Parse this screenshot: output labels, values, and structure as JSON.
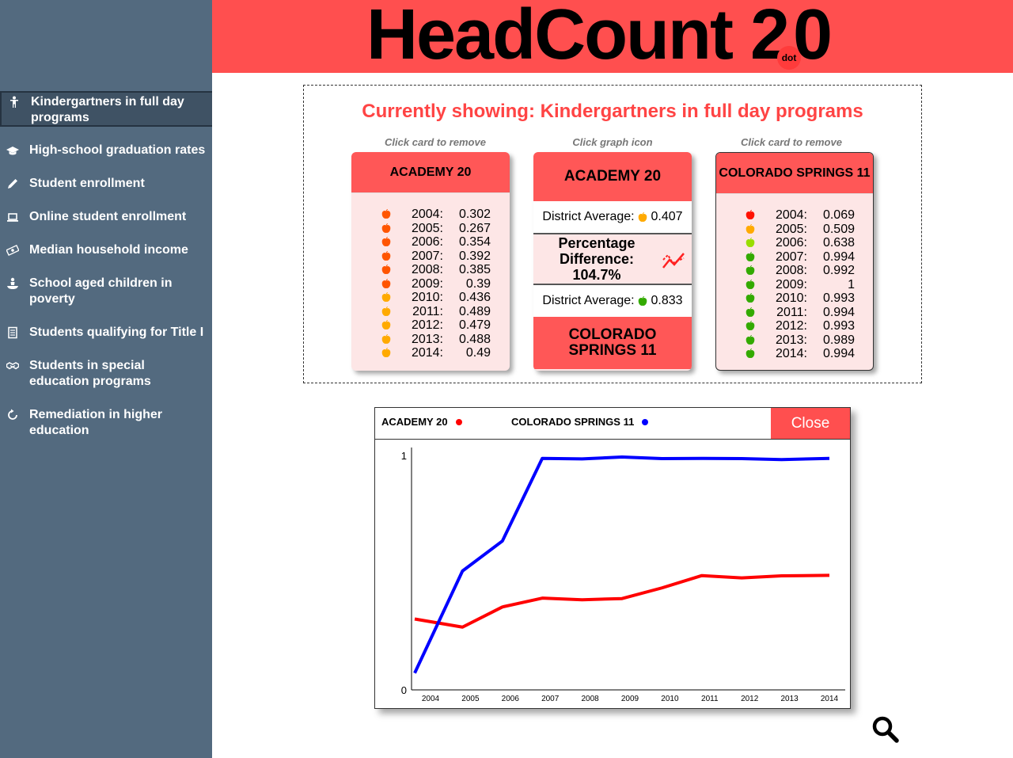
{
  "app": {
    "title_main": "HeadCount 2",
    "title_dot": "dot",
    "title_end": "0"
  },
  "sidebar": {
    "items": [
      {
        "label": "Kindergartners in full day programs",
        "icon": "child-icon",
        "active": true
      },
      {
        "label": "High-school graduation rates",
        "icon": "graduation-cap-icon",
        "active": false
      },
      {
        "label": "Student enrollment",
        "icon": "pencil-icon",
        "active": false
      },
      {
        "label": "Online student enrollment",
        "icon": "laptop-icon",
        "active": false
      },
      {
        "label": "Median household income",
        "icon": "money-icon",
        "active": false
      },
      {
        "label": "School aged children in poverty",
        "icon": "child-bowl-icon",
        "active": false
      },
      {
        "label": "Students qualifying for Title I",
        "icon": "document-icon",
        "active": false
      },
      {
        "label": "Students in special education programs",
        "icon": "handshake-icon",
        "active": false
      },
      {
        "label": "Remediation in higher education",
        "icon": "refresh-icon",
        "active": false
      }
    ]
  },
  "compare": {
    "showing": "Currently showing: Kindergartners in full day programs",
    "hint_left": "Click card to remove",
    "hint_middle": "Click graph icon",
    "hint_right": "Click card to remove",
    "left_card": {
      "title": "ACADEMY 20",
      "rows": [
        {
          "year": "2004:",
          "value": "0.302",
          "color": "#ff5500"
        },
        {
          "year": "2005:",
          "value": "0.267",
          "color": "#ff5500"
        },
        {
          "year": "2006:",
          "value": "0.354",
          "color": "#ff5500"
        },
        {
          "year": "2007:",
          "value": "0.392",
          "color": "#ff5500"
        },
        {
          "year": "2008:",
          "value": "0.385",
          "color": "#ff5500"
        },
        {
          "year": "2009:",
          "value": "0.39",
          "color": "#ff5500"
        },
        {
          "year": "2010:",
          "value": "0.436",
          "color": "#ffaa00"
        },
        {
          "year": "2011:",
          "value": "0.489",
          "color": "#ffaa00"
        },
        {
          "year": "2012:",
          "value": "0.479",
          "color": "#ffaa00"
        },
        {
          "year": "2013:",
          "value": "0.488",
          "color": "#ffaa00"
        },
        {
          "year": "2014:",
          "value": "0.49",
          "color": "#ffaa00"
        }
      ]
    },
    "middle_card": {
      "top_title": "ACADEMY 20",
      "avg_label": "District Average:",
      "avg_top_value": "0.407",
      "avg_top_color": "#ffaa00",
      "pct_line1": "Percentage",
      "pct_line2": "Difference:",
      "pct_value": "104.7%",
      "avg_bottom_value": "0.833",
      "avg_bottom_color": "#33aa00",
      "bottom_title": "COLORADO SPRINGS 11"
    },
    "right_card": {
      "title": "COLORADO SPRINGS 11",
      "rows": [
        {
          "year": "2004:",
          "value": "0.069",
          "color": "#ff1100"
        },
        {
          "year": "2005:",
          "value": "0.509",
          "color": "#ffaa00"
        },
        {
          "year": "2006:",
          "value": "0.638",
          "color": "#99dd00"
        },
        {
          "year": "2007:",
          "value": "0.994",
          "color": "#33aa00"
        },
        {
          "year": "2008:",
          "value": "0.992",
          "color": "#33aa00"
        },
        {
          "year": "2009:",
          "value": "1",
          "color": "#33aa00"
        },
        {
          "year": "2010:",
          "value": "0.993",
          "color": "#33aa00"
        },
        {
          "year": "2011:",
          "value": "0.994",
          "color": "#33aa00"
        },
        {
          "year": "2012:",
          "value": "0.993",
          "color": "#33aa00"
        },
        {
          "year": "2013:",
          "value": "0.989",
          "color": "#33aa00"
        },
        {
          "year": "2014:",
          "value": "0.994",
          "color": "#33aa00"
        }
      ]
    }
  },
  "graph": {
    "close_label": "Close"
  },
  "chart_data": {
    "type": "line",
    "categories": [
      "2004",
      "2005",
      "2006",
      "2007",
      "2008",
      "2009",
      "2010",
      "2011",
      "2012",
      "2013",
      "2014"
    ],
    "series": [
      {
        "name": "ACADEMY 20",
        "color": "#ff0000",
        "values": [
          0.302,
          0.267,
          0.354,
          0.392,
          0.385,
          0.39,
          0.436,
          0.489,
          0.479,
          0.488,
          0.49
        ]
      },
      {
        "name": "COLORADO SPRINGS 11",
        "color": "#0000ff",
        "values": [
          0.069,
          0.509,
          0.638,
          0.994,
          0.992,
          1,
          0.993,
          0.994,
          0.993,
          0.989,
          0.994
        ]
      }
    ],
    "ylim": [
      0,
      1
    ],
    "yticks": [
      "0",
      "1"
    ],
    "grid": false,
    "legend": "top-left"
  },
  "colors": {
    "brand_red": "#ff4f4f",
    "sidebar_bg": "#536a7f"
  }
}
